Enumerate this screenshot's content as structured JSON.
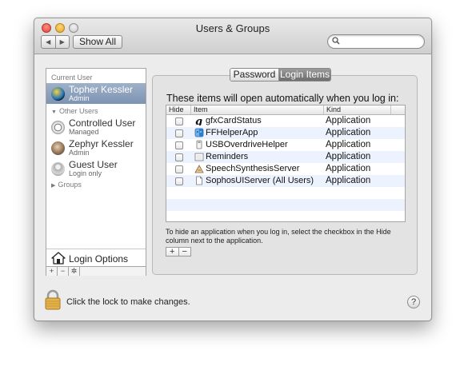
{
  "window": {
    "title": "Users & Groups"
  },
  "toolbar": {
    "show_all_label": "Show All",
    "search_placeholder": ""
  },
  "sidebar": {
    "current_user_header": "Current User",
    "current_user": {
      "name": "Topher Kessler",
      "role": "Admin"
    },
    "other_users_header": "Other Users",
    "other_users": [
      {
        "name": "Controlled User",
        "role": "Managed"
      },
      {
        "name": "Zephyr Kessler",
        "role": "Admin"
      },
      {
        "name": "Guest User",
        "role": "Login only"
      }
    ],
    "groups_header": "Groups",
    "login_options_label": "Login Options",
    "add_symbol": "+",
    "remove_symbol": "−",
    "action_symbol": "✲"
  },
  "tabs": {
    "password_label": "Password",
    "login_items_label": "Login Items",
    "selected": "Login Items"
  },
  "login_items": {
    "intro": "These items will open automatically when you log in:",
    "columns": {
      "hide": "Hide",
      "item": "Item",
      "kind": "Kind"
    },
    "rows": [
      {
        "name": "gfxCardStatus",
        "kind": "Application",
        "hide": false,
        "icon": "gfx-icon"
      },
      {
        "name": "FFHelperApp",
        "kind": "Application",
        "hide": false,
        "icon": "finder-icon"
      },
      {
        "name": "USBOverdriveHelper",
        "kind": "Application",
        "hide": false,
        "icon": "usb-icon"
      },
      {
        "name": "Reminders",
        "kind": "Application",
        "hide": false,
        "icon": "reminders-icon"
      },
      {
        "name": "SpeechSynthesisServer",
        "kind": "Application",
        "hide": false,
        "icon": "speech-icon"
      },
      {
        "name": "SophosUIServer (All Users)",
        "kind": "Application",
        "hide": false,
        "icon": "document-icon"
      }
    ],
    "hint": "To hide an application when you log in, select the checkbox in the Hide column next to the application.",
    "add_symbol": "+",
    "remove_symbol": "−"
  },
  "footer": {
    "lock_text": "Click the lock to make changes.",
    "help_symbol": "?"
  }
}
